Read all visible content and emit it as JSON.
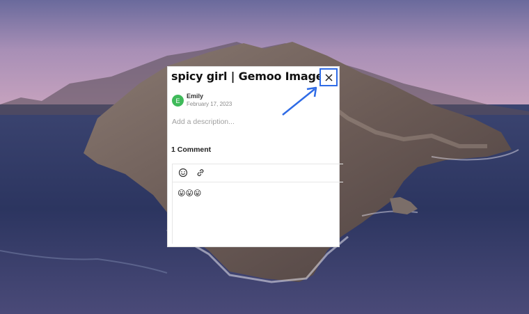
{
  "card": {
    "title": "spicy girl | Gemoo Image",
    "author": {
      "initial": "E",
      "name": "Emily",
      "date": "February 17, 2023"
    },
    "description_placeholder": "Add a description...",
    "comments_heading": "1 Comment",
    "comment_text": "😛😛😛"
  },
  "colors": {
    "highlight": "#2e6be6",
    "avatar": "#3fba5a"
  },
  "icons": {
    "close": "close-icon",
    "emoji": "emoji-icon",
    "link": "link-icon",
    "annotation": "arrow-annotation"
  }
}
